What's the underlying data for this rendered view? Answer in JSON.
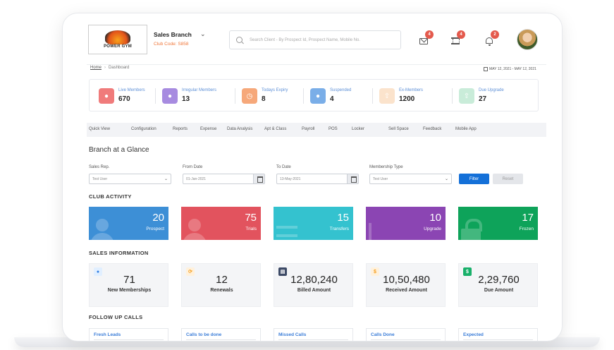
{
  "header": {
    "logo_text": "POWER GYM",
    "branch_name": "Sales Branch",
    "club_code": "Club Code: S858",
    "search_placeholder": "Search Client - By Prospect Id, Prospect Name, Mobile No.",
    "notifications": [
      {
        "icon": "mail-icon",
        "count": "4"
      },
      {
        "icon": "gym-icon",
        "count": "4"
      },
      {
        "icon": "bell-icon",
        "count": "2"
      }
    ]
  },
  "breadcrumb": {
    "home": "Home",
    "current": "Dashboard",
    "separator": "›"
  },
  "date_range": "MAY 12, 2021 - MAY 12, 2021",
  "stats": [
    {
      "label": "Live Members",
      "value": "670",
      "color": "#f07b7b",
      "icon": "person-icon"
    },
    {
      "label": "Irregular Members",
      "value": "13",
      "color": "#a78be0",
      "icon": "person-icon"
    },
    {
      "label": "Todays Expiry",
      "value": "8",
      "color": "#f6a87a",
      "icon": "clock-icon"
    },
    {
      "label": "Suspended",
      "value": "4",
      "color": "#7aaee8",
      "icon": "person-icon"
    },
    {
      "label": "Ex-Members",
      "value": "1200",
      "color": "#fbe3cc",
      "icon": "arrow-up-icon"
    },
    {
      "label": "Due Upgrade",
      "value": "27",
      "color": "#c9ecd9",
      "icon": "arrow-up-icon"
    }
  ],
  "tabs": [
    "Quick View",
    "Configuration",
    "Reports",
    "Expense",
    "Data Analysis",
    "Apt & Class",
    "Payroll",
    "POS",
    "Locker",
    "Sell Space",
    "Feedback",
    "Mobile App"
  ],
  "glance_title": "Branch at a Glance",
  "filters": {
    "sales_rep": {
      "label": "Sales Rep.",
      "value": "Test User"
    },
    "from_date": {
      "label": "From Date",
      "value": "01-Jan-2021"
    },
    "to_date": {
      "label": "To Date",
      "value": "13-May-2021"
    },
    "membership_type": {
      "label": "Membership Type",
      "value": "Test User"
    },
    "filter_button": "Filter",
    "reset_button": "Reset"
  },
  "club_activity": {
    "title": "CLUB ACTIVITY",
    "cards": [
      {
        "value": "20",
        "label": "Prospect",
        "color": "#3d8fd6",
        "icon": "person-icon"
      },
      {
        "value": "75",
        "label": "Trials",
        "color": "#e2535e",
        "icon": "person-icon"
      },
      {
        "value": "15",
        "label": "Transfers",
        "color": "#34c2cf",
        "icon": "transfer-icon"
      },
      {
        "value": "10",
        "label": "Upgrade",
        "color": "#8b45b3",
        "icon": "chart-icon"
      },
      {
        "value": "17",
        "label": "Frozen",
        "color": "#0ea35a",
        "icon": "lock-icon"
      }
    ]
  },
  "sales_information": {
    "title": "SALES INFORMATION",
    "cards": [
      {
        "value": "71",
        "label": "New Memberships",
        "icon": "user-icon",
        "glyph": "●",
        "bg": "#e1efff",
        "fg": "#2f7de1"
      },
      {
        "value": "12",
        "label": "Renewals",
        "icon": "refresh-icon",
        "glyph": "⟳",
        "bg": "#fff1dc",
        "fg": "#f59d1a"
      },
      {
        "value": "12,80,240",
        "label": "Billed Amount",
        "icon": "bill-icon",
        "glyph": "▤",
        "bg": "#3d4a66",
        "fg": "#ffffff"
      },
      {
        "value": "10,50,480",
        "label": "Received Amount",
        "icon": "dollar-icon",
        "glyph": "$",
        "bg": "#fff1dc",
        "fg": "#f59d1a"
      },
      {
        "value": "2,29,760",
        "label": "Due Amount",
        "icon": "dollar-icon",
        "glyph": "$",
        "bg": "#19b06a",
        "fg": "#ffffff"
      }
    ]
  },
  "follow_up": {
    "title": "FOLLOW UP CALLS",
    "cards": [
      "Fresh Leads",
      "Calls to be done",
      "Missed Calls",
      "Calls Done",
      "Expected"
    ]
  }
}
